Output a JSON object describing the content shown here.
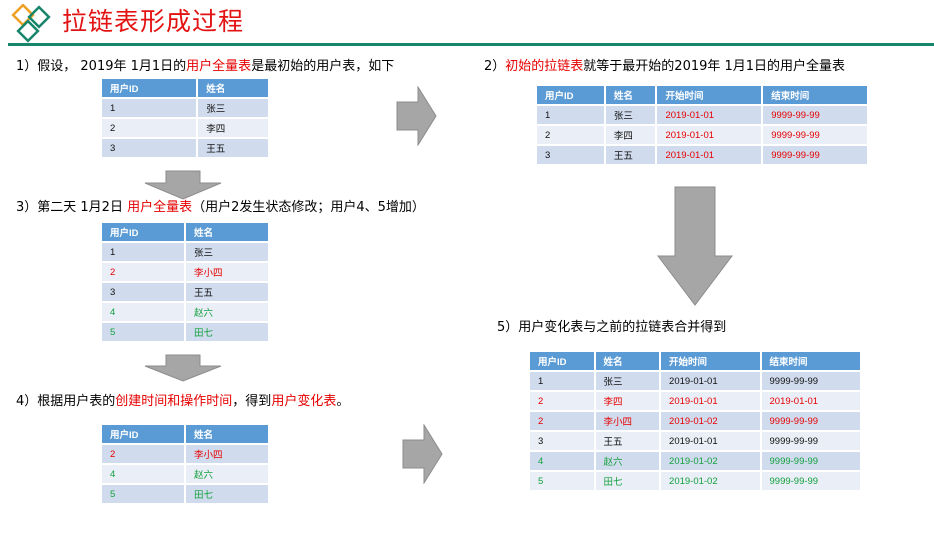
{
  "header": {
    "title": "拉链表形成过程",
    "logo_icon": "diamonds-logo-icon"
  },
  "colors": {
    "title": "#e41313",
    "rule": "#17856a",
    "table_header": "#5b9bd5",
    "row_dark": "#d0dcee",
    "row_light": "#e9eef7",
    "changed": "#e60000",
    "added": "#13a03c",
    "arrow": "#a6a6a6"
  },
  "steps": {
    "s1": {
      "pre": "1）假设， 2019年 1月1日的",
      "hl": "用户全量表",
      "post": "是最初始的用户表，如下"
    },
    "s2": {
      "pre": "2）",
      "hl": "初始的拉链表",
      "post": "就等于最开始的2019年 1月1日的用户全量表"
    },
    "s3": {
      "pre": "3）第二天 1月2日 ",
      "hl": "用户全量表",
      "post": "（用户2发生状态修改；用户4、5增加）"
    },
    "s4": {
      "pre": "4）根据用户表的",
      "hl": "创建时间和操作时间",
      "mid": "，得到",
      "hl2": "用户变化表",
      "post": "。"
    },
    "s5": {
      "pre": "5）用户变化表与之前的拉链表合并得到"
    }
  },
  "tables": {
    "t1": {
      "headers": [
        "用户ID",
        "姓名"
      ],
      "rows": [
        {
          "cells": [
            "1",
            "张三"
          ],
          "status": "black"
        },
        {
          "cells": [
            "2",
            "李四"
          ],
          "status": "black"
        },
        {
          "cells": [
            "3",
            "王五"
          ],
          "status": "black"
        }
      ]
    },
    "t2": {
      "headers": [
        "用户ID",
        "姓名",
        "开始时间",
        "结束时间"
      ],
      "rows": [
        {
          "cells": [
            "1",
            "张三",
            "2019-01-01",
            "9999-99-99"
          ]
        },
        {
          "cells": [
            "2",
            "李四",
            "2019-01-01",
            "9999-99-99"
          ]
        },
        {
          "cells": [
            "3",
            "王五",
            "2019-01-01",
            "9999-99-99"
          ]
        }
      ]
    },
    "t3": {
      "headers": [
        "用户ID",
        "姓名"
      ],
      "rows": [
        {
          "cells": [
            "1",
            "张三"
          ],
          "status": "black"
        },
        {
          "cells": [
            "2",
            "李小四"
          ],
          "status": "red"
        },
        {
          "cells": [
            "3",
            "王五"
          ],
          "status": "black"
        },
        {
          "cells": [
            "4",
            "赵六"
          ],
          "status": "green"
        },
        {
          "cells": [
            "5",
            "田七"
          ],
          "status": "green"
        }
      ]
    },
    "t4": {
      "headers": [
        "用户ID",
        "姓名"
      ],
      "rows": [
        {
          "cells": [
            "2",
            "李小四"
          ],
          "status": "red"
        },
        {
          "cells": [
            "4",
            "赵六"
          ],
          "status": "green"
        },
        {
          "cells": [
            "5",
            "田七"
          ],
          "status": "green"
        }
      ]
    },
    "t5": {
      "headers": [
        "用户ID",
        "姓名",
        "开始时间",
        "结束时间"
      ],
      "rows": [
        {
          "cells": [
            "1",
            "张三",
            "2019-01-01",
            "9999-99-99"
          ],
          "status": "black"
        },
        {
          "cells": [
            "2",
            "李四",
            "2019-01-01",
            "2019-01-01"
          ],
          "status": "red"
        },
        {
          "cells": [
            "2",
            "李小四",
            "2019-01-02",
            "9999-99-99"
          ],
          "status": "red"
        },
        {
          "cells": [
            "3",
            "王五",
            "2019-01-01",
            "9999-99-99"
          ],
          "status": "black"
        },
        {
          "cells": [
            "4",
            "赵六",
            "2019-01-02",
            "9999-99-99"
          ],
          "status": "green"
        },
        {
          "cells": [
            "5",
            "田七",
            "2019-01-02",
            "9999-99-99"
          ],
          "status": "green"
        }
      ]
    }
  },
  "arrows": [
    {
      "name": "arrow-right-1",
      "direction": "right"
    },
    {
      "name": "arrow-down-1",
      "direction": "down"
    },
    {
      "name": "arrow-down-2",
      "direction": "down"
    },
    {
      "name": "arrow-down-3",
      "direction": "down"
    },
    {
      "name": "arrow-right-2",
      "direction": "right"
    }
  ]
}
